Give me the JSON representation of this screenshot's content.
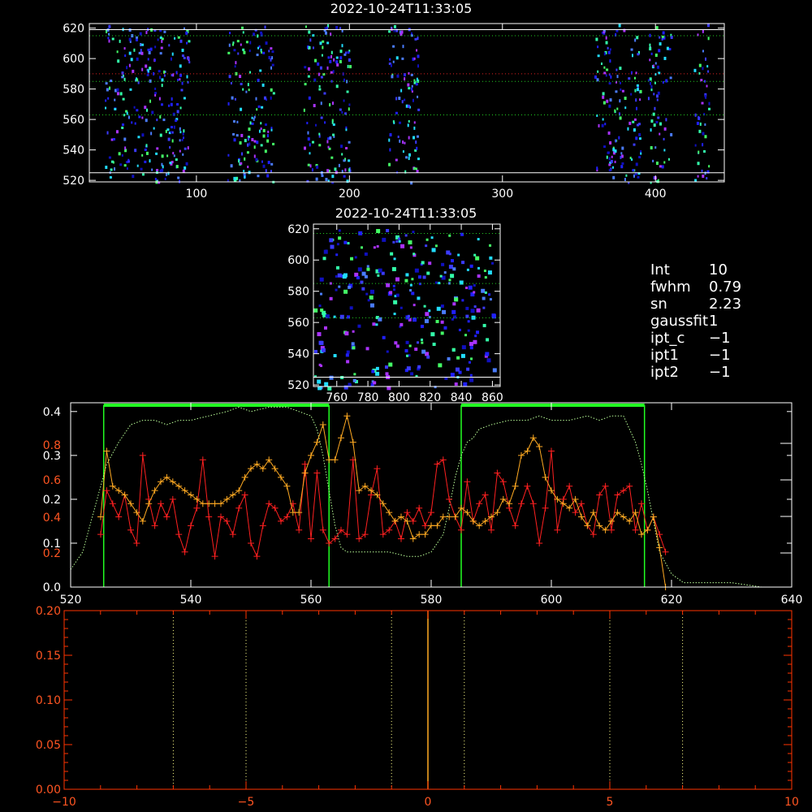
{
  "panels": {
    "top": {
      "title": "2022-10-24T11:33:05",
      "xticks": [
        "100",
        "200",
        "300",
        "400"
      ],
      "yticks": [
        "520",
        "540",
        "560",
        "580",
        "600",
        "620"
      ]
    },
    "middle": {
      "title": "2022-10-24T11:33:05",
      "xticks": [
        "760",
        "780",
        "800",
        "820",
        "840",
        "860"
      ],
      "yticks": [
        "520",
        "540",
        "560",
        "580",
        "600",
        "620"
      ]
    }
  },
  "info": [
    {
      "key": "Int",
      "value": "10"
    },
    {
      "key": "fwhm",
      "value": "0.79"
    },
    {
      "key": "sn",
      "value": "2.23"
    },
    {
      "key": "gaussfit",
      "value": "1"
    },
    {
      "key": "ipt_c",
      "value": "−1"
    },
    {
      "key": "ipt1",
      "value": "−1"
    },
    {
      "key": "ipt2",
      "value": "−1"
    }
  ],
  "chart_data": [
    {
      "type": "heatmap",
      "title": "2022-10-24T11:33:05",
      "xlim": [
        30,
        445
      ],
      "ylim": [
        519,
        623
      ],
      "xticks": [
        100,
        200,
        300,
        400
      ],
      "yticks": [
        520,
        540,
        560,
        580,
        600,
        620
      ],
      "bright_columns": [
        [
          40,
          95
        ],
        [
          120,
          150
        ],
        [
          170,
          200
        ],
        [
          225,
          245
        ],
        [
          360,
          390
        ],
        [
          395,
          410
        ],
        [
          425,
          435
        ]
      ],
      "lines": [
        {
          "y": 525,
          "style": "solid",
          "color": "#ffffff"
        },
        {
          "y": 619,
          "style": "solid",
          "color": "#ffffff"
        },
        {
          "y": 563,
          "style": "dotted",
          "color": "#22cc22"
        },
        {
          "y": 585,
          "style": "dotted",
          "color": "#22cc22"
        },
        {
          "y": 615,
          "style": "dotted",
          "color": "#22cc22"
        },
        {
          "y": 590,
          "style": "dotted",
          "color": "#dd2222"
        }
      ]
    },
    {
      "type": "heatmap",
      "title": "2022-10-24T11:33:05",
      "xlim": [
        745,
        865
      ],
      "ylim": [
        519,
        623
      ],
      "xticks": [
        760,
        780,
        800,
        820,
        840,
        860
      ],
      "yticks": [
        520,
        540,
        560,
        580,
        600,
        620
      ],
      "lines": [
        {
          "y": 525,
          "style": "solid",
          "color": "#ffffff"
        },
        {
          "y": 563,
          "style": "dotted",
          "color": "#22cc22"
        },
        {
          "y": 585,
          "style": "dotted",
          "color": "#22cc22"
        },
        {
          "y": 617,
          "style": "dotted",
          "color": "#22cc22"
        }
      ]
    },
    {
      "type": "line",
      "xlim": [
        520,
        640
      ],
      "xticks": [
        520,
        540,
        560,
        580,
        600,
        620,
        640
      ],
      "left_axis_top_ticks": [
        "0.4",
        "0.3",
        "0.2",
        "0.1",
        "0.0"
      ],
      "left_axis_bottom_ticks": [
        "0.8",
        "0.6",
        "0.4",
        "0.2"
      ],
      "green_windows": [
        [
          525.5,
          563
        ],
        [
          585,
          615.5
        ]
      ],
      "series": [
        {
          "color": "#ff2020",
          "x": [
            525,
            526,
            527,
            528,
            529,
            530,
            531,
            532,
            533,
            534,
            535,
            536,
            537,
            538,
            539,
            540,
            541,
            542,
            543,
            544,
            545,
            546,
            547,
            548,
            549,
            550,
            551,
            552,
            553,
            554,
            555,
            556,
            557,
            558,
            559,
            560,
            561,
            562,
            563,
            564,
            565,
            566,
            567,
            568,
            569,
            570,
            571,
            572,
            573,
            574,
            575,
            576,
            577,
            578,
            579,
            580,
            581,
            582,
            583,
            584,
            585,
            586,
            587,
            588,
            589,
            590,
            591,
            592,
            593,
            594,
            595,
            596,
            597,
            598,
            599,
            600,
            601,
            602,
            603,
            604,
            605,
            606,
            607,
            608,
            609,
            610,
            611,
            612,
            613,
            614,
            615,
            616,
            617,
            618,
            619
          ],
          "y": [
            0.12,
            0.22,
            0.19,
            0.16,
            0.21,
            0.13,
            0.1,
            0.3,
            0.2,
            0.14,
            0.19,
            0.16,
            0.2,
            0.12,
            0.08,
            0.14,
            0.18,
            0.29,
            0.16,
            0.07,
            0.16,
            0.15,
            0.12,
            0.18,
            0.21,
            0.1,
            0.07,
            0.14,
            0.19,
            0.18,
            0.15,
            0.16,
            0.19,
            0.13,
            0.28,
            0.11,
            0.26,
            0.13,
            0.1,
            0.11,
            0.13,
            0.12,
            0.29,
            0.11,
            0.12,
            0.21,
            0.27,
            0.12,
            0.13,
            0.15,
            0.11,
            0.17,
            0.15,
            0.18,
            0.14,
            0.17,
            0.28,
            0.29,
            0.2,
            0.16,
            0.13,
            0.24,
            0.15,
            0.19,
            0.21,
            0.13,
            0.26,
            0.24,
            0.18,
            0.14,
            0.19,
            0.23,
            0.19,
            0.1,
            0.18,
            0.31,
            0.13,
            0.2,
            0.23,
            0.17,
            0.19,
            0.14,
            0.12,
            0.21,
            0.23,
            0.13,
            0.21,
            0.22,
            0.23,
            0.13,
            0.19,
            0.13,
            0.16,
            0.12,
            0.08
          ]
        },
        {
          "color": "#ffaa22",
          "x": [
            525,
            526,
            527,
            528,
            529,
            530,
            531,
            532,
            533,
            534,
            535,
            536,
            537,
            538,
            539,
            540,
            541,
            542,
            543,
            544,
            545,
            546,
            547,
            548,
            549,
            550,
            551,
            552,
            553,
            554,
            555,
            556,
            557,
            558,
            559,
            560,
            561,
            562,
            563,
            564,
            565,
            566,
            567,
            568,
            569,
            570,
            571,
            572,
            573,
            574,
            575,
            576,
            577,
            578,
            579,
            580,
            581,
            582,
            583,
            584,
            585,
            586,
            587,
            588,
            589,
            590,
            591,
            592,
            593,
            594,
            595,
            596,
            597,
            598,
            599,
            600,
            601,
            602,
            603,
            604,
            605,
            606,
            607,
            608,
            609,
            610,
            611,
            612,
            613,
            614,
            615,
            616,
            617,
            618,
            619
          ],
          "y": [
            0.16,
            0.31,
            0.23,
            0.22,
            0.21,
            0.19,
            0.17,
            0.15,
            0.19,
            0.22,
            0.24,
            0.25,
            0.24,
            0.23,
            0.22,
            0.21,
            0.2,
            0.19,
            0.19,
            0.19,
            0.19,
            0.2,
            0.21,
            0.22,
            0.25,
            0.27,
            0.28,
            0.27,
            0.29,
            0.27,
            0.25,
            0.23,
            0.17,
            0.17,
            0.26,
            0.3,
            0.33,
            0.37,
            0.29,
            0.29,
            0.34,
            0.39,
            0.33,
            0.22,
            0.23,
            0.22,
            0.21,
            0.19,
            0.17,
            0.15,
            0.16,
            0.15,
            0.11,
            0.12,
            0.12,
            0.14,
            0.14,
            0.16,
            0.16,
            0.16,
            0.18,
            0.17,
            0.15,
            0.14,
            0.15,
            0.16,
            0.17,
            0.2,
            0.19,
            0.23,
            0.3,
            0.31,
            0.34,
            0.32,
            0.25,
            0.22,
            0.2,
            0.19,
            0.18,
            0.2,
            0.16,
            0.14,
            0.17,
            0.14,
            0.13,
            0.15,
            0.17,
            0.16,
            0.15,
            0.17,
            0.12,
            0.13,
            0.16,
            0.09,
            0.0
          ]
        },
        {
          "color": "#bbff99",
          "style": "dotted",
          "x": [
            520,
            522,
            524,
            526,
            528,
            530,
            532,
            534,
            536,
            538,
            540,
            543,
            546,
            548,
            550,
            553,
            556,
            558,
            560,
            561,
            562,
            563,
            564,
            565,
            566,
            567,
            568,
            570,
            573,
            576,
            578,
            580,
            581,
            582,
            583,
            584,
            585,
            586,
            587,
            588,
            590,
            593,
            596,
            598,
            600,
            603,
            606,
            608,
            610,
            612,
            613,
            614,
            615,
            616,
            617,
            618,
            620,
            622,
            625,
            630,
            635,
            640
          ],
          "y": [
            0.04,
            0.08,
            0.18,
            0.28,
            0.33,
            0.37,
            0.38,
            0.38,
            0.37,
            0.38,
            0.38,
            0.39,
            0.4,
            0.41,
            0.4,
            0.41,
            0.41,
            0.4,
            0.39,
            0.36,
            0.3,
            0.22,
            0.14,
            0.09,
            0.08,
            0.08,
            0.08,
            0.08,
            0.08,
            0.07,
            0.07,
            0.08,
            0.1,
            0.12,
            0.18,
            0.25,
            0.3,
            0.33,
            0.34,
            0.36,
            0.37,
            0.38,
            0.38,
            0.39,
            0.38,
            0.38,
            0.39,
            0.38,
            0.39,
            0.39,
            0.36,
            0.33,
            0.28,
            0.22,
            0.15,
            0.08,
            0.03,
            0.01,
            0.01,
            0.01,
            0.0,
            0.0
          ]
        }
      ]
    },
    {
      "type": "line",
      "xlim": [
        -10,
        10
      ],
      "ylim": [
        0,
        0.2
      ],
      "xticks": [
        -10,
        -5,
        0,
        5,
        10
      ],
      "xtick_labels": [
        "−10",
        "−5",
        "0",
        "5",
        "10"
      ],
      "yticks": [
        0.0,
        0.05,
        0.1,
        0.15,
        0.2
      ],
      "ytick_labels": [
        "0.00",
        "0.05",
        "0.10",
        "0.15",
        "0.20"
      ],
      "dotted_verticals": [
        -7,
        -5,
        -1,
        1,
        5,
        7
      ],
      "solid_verticals": [
        0
      ]
    }
  ]
}
